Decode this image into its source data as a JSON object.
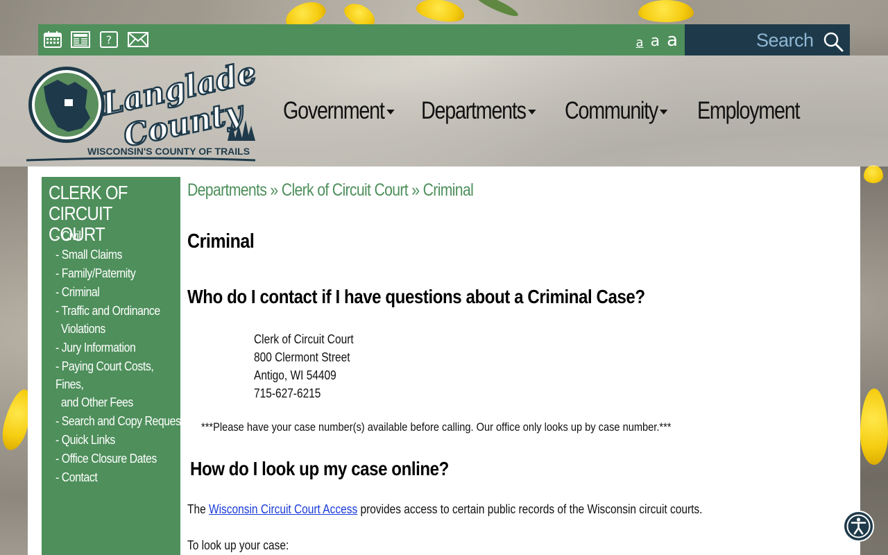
{
  "utility_bar": {
    "icons": [
      "calendar-icon",
      "news-icon",
      "help-icon",
      "mail-icon"
    ],
    "font_sizes": [
      "a",
      "a",
      "a"
    ],
    "search_label": "Search"
  },
  "logo": {
    "line1": "Langlade",
    "line2": "County",
    "tagline": "WISCONSIN'S COUNTY OF TRAILS"
  },
  "nav": {
    "items": [
      {
        "label": "Government",
        "dropdown": true
      },
      {
        "label": "Departments",
        "dropdown": true
      },
      {
        "label": "Community",
        "dropdown": true
      },
      {
        "label": "Employment",
        "dropdown": false
      }
    ]
  },
  "sidebar": {
    "title": "CLERK OF CIRCUIT COURT",
    "items": [
      {
        "label": "- Civil"
      },
      {
        "label": "- Small Claims"
      },
      {
        "label": "- Family/Paternity"
      },
      {
        "label": "- Criminal"
      },
      {
        "label": "- Traffic and Ordinance",
        "cont": "Violations"
      },
      {
        "label": "- Jury Information"
      },
      {
        "label": "- Paying Court Costs, Fines,",
        "cont": "and Other Fees"
      },
      {
        "label": "- Search and Copy Requests"
      },
      {
        "label": "- Quick Links"
      },
      {
        "label": "- Office Closure Dates"
      },
      {
        "label": "- Contact"
      }
    ]
  },
  "breadcrumb": {
    "items": [
      "Departments",
      "Clerk of Circuit Court",
      "Criminal"
    ],
    "separator": "»"
  },
  "main": {
    "title": "Criminal",
    "heading1": "Who do I contact if I have questions about a Criminal Case?",
    "address": {
      "line1": "Clerk of Circuit Court",
      "line2": "800 Clermont Street",
      "line3": "Antigo, WI 54409",
      "phone": "715-627-6215"
    },
    "note": "***Please have your case number(s) available before calling.  Our office only looks up by case number.***",
    "heading2": "How do I look up my case online?",
    "para_prefix": "The ",
    "link_text": "Wisconsin Circuit Court Access",
    "para_suffix": " provides access to certain public records of the Wisconsin circuit courts.",
    "para2": "To look up your case:"
  },
  "colors": {
    "green": "#4e8f5b",
    "dark_navy": "#1e3a4a",
    "link": "#1a3bd8"
  }
}
